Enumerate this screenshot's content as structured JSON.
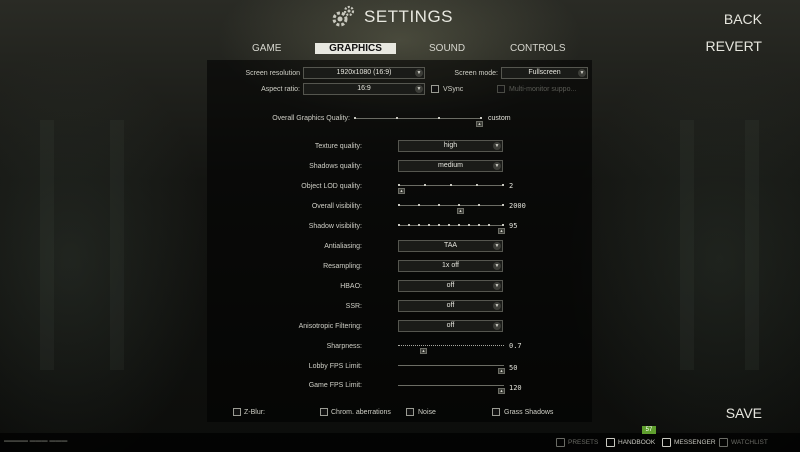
{
  "header": {
    "title": "SETTINGS"
  },
  "actions": {
    "back": "BACK",
    "revert": "REVERT",
    "save": "SAVE"
  },
  "tabs": [
    {
      "label": "GAME",
      "active": false
    },
    {
      "label": "GRAPHICS",
      "active": true
    },
    {
      "label": "SOUND",
      "active": false
    },
    {
      "label": "CONTROLS",
      "active": false
    }
  ],
  "display": {
    "screen_resolution": {
      "label": "Screen resolution",
      "value": "1920x1080 (16:9)"
    },
    "screen_mode": {
      "label": "Screen mode:",
      "value": "Fullscreen"
    },
    "aspect_ratio": {
      "label": "Aspect ratio:",
      "value": "16:9"
    },
    "vsync": {
      "label": "VSync",
      "checked": false
    },
    "multi_monitor": {
      "label": "Multi-monitor suppo...",
      "checked": false,
      "disabled": true
    }
  },
  "overall_quality": {
    "label": "Overall Graphics Quality:",
    "value": "custom"
  },
  "texture_quality": {
    "label": "Texture quality:",
    "value": "high"
  },
  "shadows_quality": {
    "label": "Shadows quality:",
    "value": "medium"
  },
  "lod_quality": {
    "label": "Object LOD quality:",
    "value": "2"
  },
  "overall_visibility": {
    "label": "Overall visibility:",
    "value": "2000"
  },
  "shadow_visibility": {
    "label": "Shadow visibility:",
    "value": "95"
  },
  "antialiasing": {
    "label": "Antialiasing:",
    "value": "TAA"
  },
  "resampling": {
    "label": "Resampling:",
    "value": "1x off"
  },
  "hbao": {
    "label": "HBAO:",
    "value": "off"
  },
  "ssr": {
    "label": "SSR:",
    "value": "off"
  },
  "anisotropic": {
    "label": "Anisotropic Filtering:",
    "value": "off"
  },
  "sharpness": {
    "label": "Sharpness:",
    "value": "0.7"
  },
  "lobby_fps": {
    "label": "Lobby FPS Limit:",
    "value": "50"
  },
  "game_fps": {
    "label": "Game FPS Limit:",
    "value": "120"
  },
  "checkboxes": {
    "zblur": {
      "label": "Z-Blur:",
      "checked": false
    },
    "chromatic": {
      "label": "Chrom. aberrations",
      "checked": false
    },
    "noise": {
      "label": "Noise",
      "checked": false
    },
    "grass_shadows": {
      "label": "Grass Shadows",
      "checked": false
    }
  },
  "bottom_bar": {
    "presets": "PRESETS",
    "handbook": "HANDBOOK",
    "handbook_badge": "57",
    "messenger": "MESSENGER",
    "watchlist": "WATCHLIST"
  },
  "icons": {
    "gear": "gear-icon",
    "dropdown": "chevron-down-icon",
    "thumb": "chevron-up-icon"
  },
  "colors": {
    "accent_badge": "#5f9f2e",
    "tab_active_bg": "#e8e8e0"
  }
}
